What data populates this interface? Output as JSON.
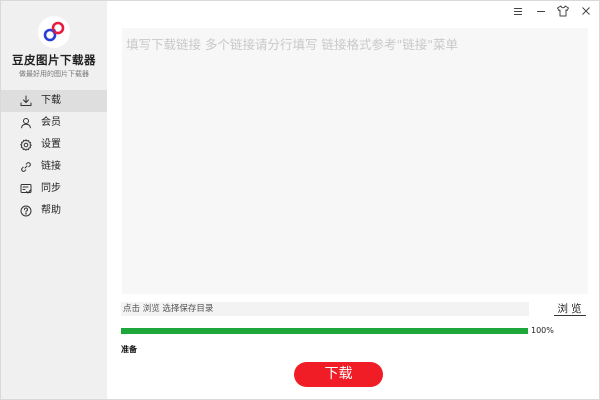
{
  "app": {
    "name": "豆皮图片下载器",
    "slogan": "做最好用的图片下载器",
    "logo_icon": "infinity-logo-icon"
  },
  "titlebar": {
    "buttons": [
      {
        "icon": "menu-icon"
      },
      {
        "icon": "minimize-icon"
      },
      {
        "icon": "shirt-skin-icon"
      },
      {
        "icon": "close-icon"
      }
    ]
  },
  "sidebar": {
    "items": [
      {
        "label": "下载",
        "icon": "download-icon",
        "active": true
      },
      {
        "label": "会员",
        "icon": "user-icon"
      },
      {
        "label": "设置",
        "icon": "gear-icon"
      },
      {
        "label": "链接",
        "icon": "link-icon"
      },
      {
        "label": "同步",
        "icon": "sync-icon"
      },
      {
        "label": "帮助",
        "icon": "help-icon"
      }
    ]
  },
  "main": {
    "urls_placeholder": "填写下载链接 多个链接请分行填写 链接格式参考\"链接\"菜单",
    "urls_value": "",
    "save_path_placeholder": "点击 浏览 选择保存目录",
    "browse_label": "浏览",
    "progress_percent": 100,
    "progress_text": "100%",
    "status_text": "准备",
    "download_label": "下载"
  },
  "colors": {
    "accent": "#f01c26",
    "progress": "#1ea83c",
    "sidebar_bg": "#f0f0f0",
    "logo_blue": "#2540d8",
    "logo_red": "#e81c3c"
  }
}
